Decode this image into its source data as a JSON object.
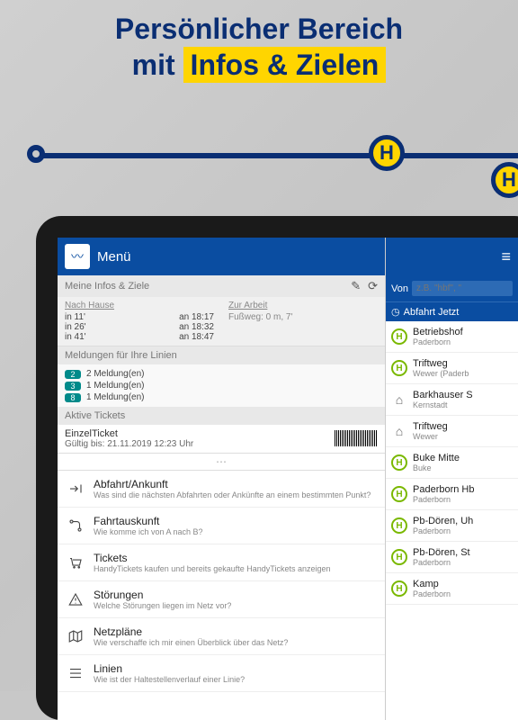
{
  "promo": {
    "line1": "Persönlicher Bereich",
    "line2_pre": "mit ",
    "line2_hl": "Infos & Zielen",
    "h_label": "H"
  },
  "appbar": {
    "title": "Menü"
  },
  "sections": {
    "infos": "Meine Infos & Ziele",
    "meldungen": "Meldungen für Ihre Linien",
    "tickets": "Aktive Tickets"
  },
  "shortcuts": {
    "home": {
      "label": "Nach Hause",
      "rows": [
        [
          "in 11'",
          "an 18:17"
        ],
        [
          "in 26'",
          "an 18:32"
        ],
        [
          "in 41'",
          "an 18:47"
        ]
      ]
    },
    "work": {
      "label": "Zur Arbeit",
      "detail": "Fußweg: 0 m, 7'"
    }
  },
  "alerts": [
    {
      "line": "2",
      "text": "2 Meldung(en)"
    },
    {
      "line": "3",
      "text": "1 Meldung(en)"
    },
    {
      "line": "8",
      "text": "1 Meldung(en)"
    }
  ],
  "ticket": {
    "type": "EinzelTicket",
    "valid": "Gültig bis: 21.11.2019 12:23 Uhr"
  },
  "menu": [
    {
      "icon": "depart",
      "title": "Abfahrt/Ankunft",
      "sub": "Was sind die nächsten Abfahrten oder Ankünfte an einem bestimmten Punkt?"
    },
    {
      "icon": "journey",
      "title": "Fahrtauskunft",
      "sub": "Wie komme ich von A nach B?"
    },
    {
      "icon": "cart",
      "title": "Tickets",
      "sub": "HandyTickets kaufen und bereits gekaufte HandyTickets anzeigen"
    },
    {
      "icon": "warn",
      "title": "Störungen",
      "sub": "Welche Störungen liegen im Netz vor?"
    },
    {
      "icon": "map",
      "title": "Netzpläne",
      "sub": "Wie verschaffe ich mir einen Überblick über das Netz?"
    },
    {
      "icon": "lines",
      "title": "Linien",
      "sub": "Wie ist der Haltestellenverlauf einer Linie?"
    }
  ],
  "search": {
    "von": "Von",
    "placeholder": "z.B. \"hbf\", \"",
    "depart": "Abfahrt Jetzt"
  },
  "stops": [
    {
      "type": "bus",
      "name": "Betriebshof",
      "sub": "Paderborn"
    },
    {
      "type": "bus",
      "name": "Triftweg",
      "sub": "Wewer (Paderb"
    },
    {
      "type": "home",
      "name": "Barkhauser S",
      "sub": "Kernstadt"
    },
    {
      "type": "home",
      "name": "Triftweg",
      "sub": "Wewer"
    },
    {
      "type": "bus",
      "name": "Buke Mitte",
      "sub": "Buke"
    },
    {
      "type": "bus",
      "name": "Paderborn Hb",
      "sub": "Paderborn"
    },
    {
      "type": "bus",
      "name": "Pb-Dören, Uh",
      "sub": "Paderborn"
    },
    {
      "type": "bus",
      "name": "Pb-Dören, St",
      "sub": "Paderborn"
    },
    {
      "type": "bus",
      "name": "Kamp",
      "sub": "Paderborn"
    }
  ]
}
